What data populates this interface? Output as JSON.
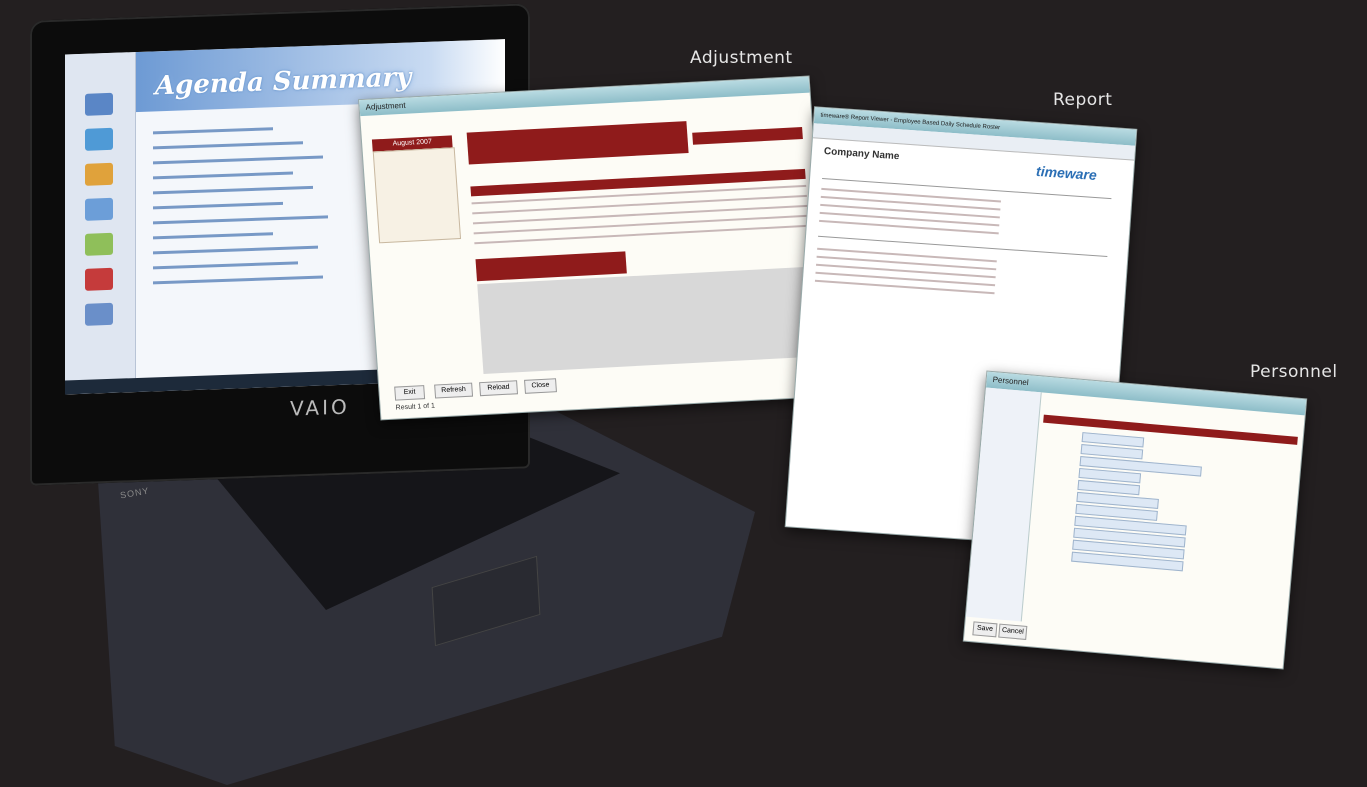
{
  "captions": {
    "adjustment": "Adjustment",
    "report": "Report",
    "personnel": "Personnel"
  },
  "laptop": {
    "screen_title": "Agenda Summary",
    "brand": "VAIO",
    "maker": "SONY"
  },
  "adjustment_window": {
    "tab": "Adjustment",
    "month": "August 2007",
    "buttons": [
      "Exit",
      "Refresh",
      "Reload",
      "Close"
    ],
    "footer": "Result 1 of 1"
  },
  "report_window": {
    "title": "timeware® Report Viewer - Employee Based Daily Schedule Roster",
    "company": "Company Name",
    "logo": "timeware"
  },
  "personnel_window": {
    "tab": "Personnel",
    "buttons": [
      "Save",
      "Cancel"
    ]
  },
  "colors": {
    "background": "#231f20",
    "accent_red": "#8f1b1b"
  }
}
